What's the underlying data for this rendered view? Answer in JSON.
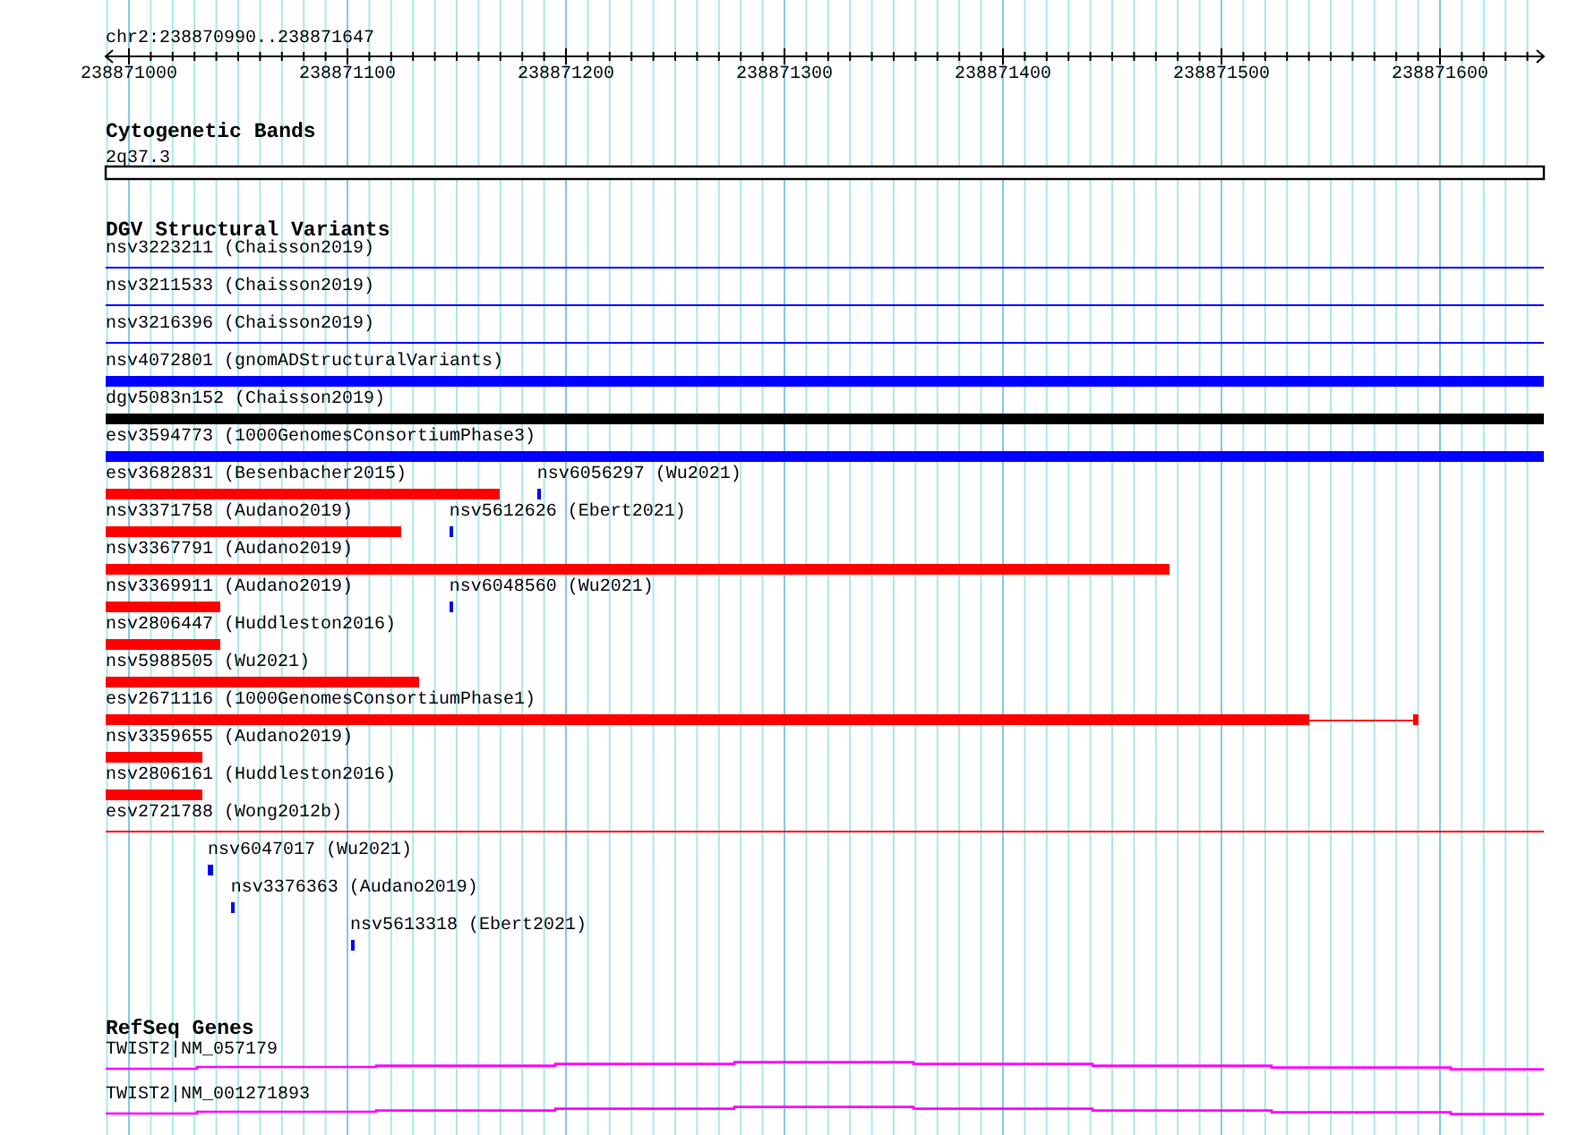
{
  "ruler": {
    "location": "chr2:238870990..238871647",
    "ticks": [
      "238871000",
      "238871100",
      "238871200",
      "238871300",
      "238871400",
      "238871500",
      "238871600"
    ]
  },
  "tracks": [
    {
      "kind": "bands",
      "title": "Cytogenetic Bands",
      "features": [
        {
          "label": "2q37.3"
        }
      ]
    },
    {
      "kind": "variants",
      "title": "DGV Structural Variants",
      "rows": [
        {
          "features": [
            {
              "kind": "line",
              "label": "nsv3223211 (Chaisson2019)",
              "color": "#0000ff"
            }
          ]
        },
        {
          "features": [
            {
              "kind": "line",
              "label": "nsv3211533 (Chaisson2019)",
              "color": "#0000ff"
            }
          ]
        },
        {
          "features": [
            {
              "kind": "line",
              "label": "nsv3216396 (Chaisson2019)",
              "color": "#0000ff"
            }
          ]
        },
        {
          "features": [
            {
              "kind": "bar",
              "label": "nsv4072801 (gnomADStructuralVariants)",
              "color": "#0000ff"
            }
          ]
        },
        {
          "features": [
            {
              "kind": "bar",
              "label": "dgv5083n152 (Chaisson2019)",
              "color": "#000000"
            }
          ]
        },
        {
          "features": [
            {
              "kind": "bar",
              "label": "esv3594773 (1000GenomesConsortiumPhase3)",
              "color": "#0000ff"
            }
          ]
        },
        {
          "features": [
            {
              "kind": "bar",
              "label": "esv3682831 (Besenbacher2015)",
              "color": "#ff0000"
            },
            {
              "kind": "tick",
              "label": "nsv6056297 (Wu2021)",
              "color": "#0000ff"
            }
          ]
        },
        {
          "features": [
            {
              "kind": "bar",
              "label": "nsv3371758 (Audano2019)",
              "color": "#ff0000"
            },
            {
              "kind": "tick",
              "label": "nsv5612626 (Ebert2021)",
              "color": "#0000ff"
            }
          ]
        },
        {
          "features": [
            {
              "kind": "bar",
              "label": "nsv3367791 (Audano2019)",
              "color": "#ff0000"
            }
          ]
        },
        {
          "features": [
            {
              "kind": "bar",
              "label": "nsv3369911 (Audano2019)",
              "color": "#ff0000"
            },
            {
              "kind": "tick",
              "label": "nsv6048560 (Wu2021)",
              "color": "#0000ff"
            }
          ]
        },
        {
          "features": [
            {
              "kind": "bar",
              "label": "nsv2806447 (Huddleston2016)",
              "color": "#ff0000"
            }
          ]
        },
        {
          "features": [
            {
              "kind": "bar",
              "label": "nsv5988505 (Wu2021)",
              "color": "#ff0000"
            }
          ]
        },
        {
          "features": [
            {
              "kind": "split",
              "label": "esv2671116 (1000GenomesConsortiumPhase1)",
              "color": "#ff0000"
            }
          ]
        },
        {
          "features": [
            {
              "kind": "bar",
              "label": "nsv3359655 (Audano2019)",
              "color": "#ff0000"
            }
          ]
        },
        {
          "features": [
            {
              "kind": "bar",
              "label": "nsv2806161 (Huddleston2016)",
              "color": "#ff0000"
            }
          ]
        },
        {
          "features": [
            {
              "kind": "line",
              "label": "esv2721788 (Wong2012b)",
              "color": "#ff0000"
            }
          ]
        },
        {
          "features": [
            {
              "kind": "tick",
              "label": "nsv6047017 (Wu2021)",
              "color": "#0000ff"
            }
          ]
        },
        {
          "features": [
            {
              "kind": "tick",
              "label": "nsv3376363 (Audano2019)",
              "color": "#0000ff"
            }
          ]
        },
        {
          "features": [
            {
              "kind": "tick",
              "label": "nsv5613318 (Ebert2021)",
              "color": "#0000ff"
            }
          ]
        }
      ]
    },
    {
      "kind": "genes",
      "title": "RefSeq Genes",
      "features": [
        {
          "label": "TWIST2|NM_057179"
        },
        {
          "label": "TWIST2|NM_001271893"
        }
      ]
    }
  ]
}
